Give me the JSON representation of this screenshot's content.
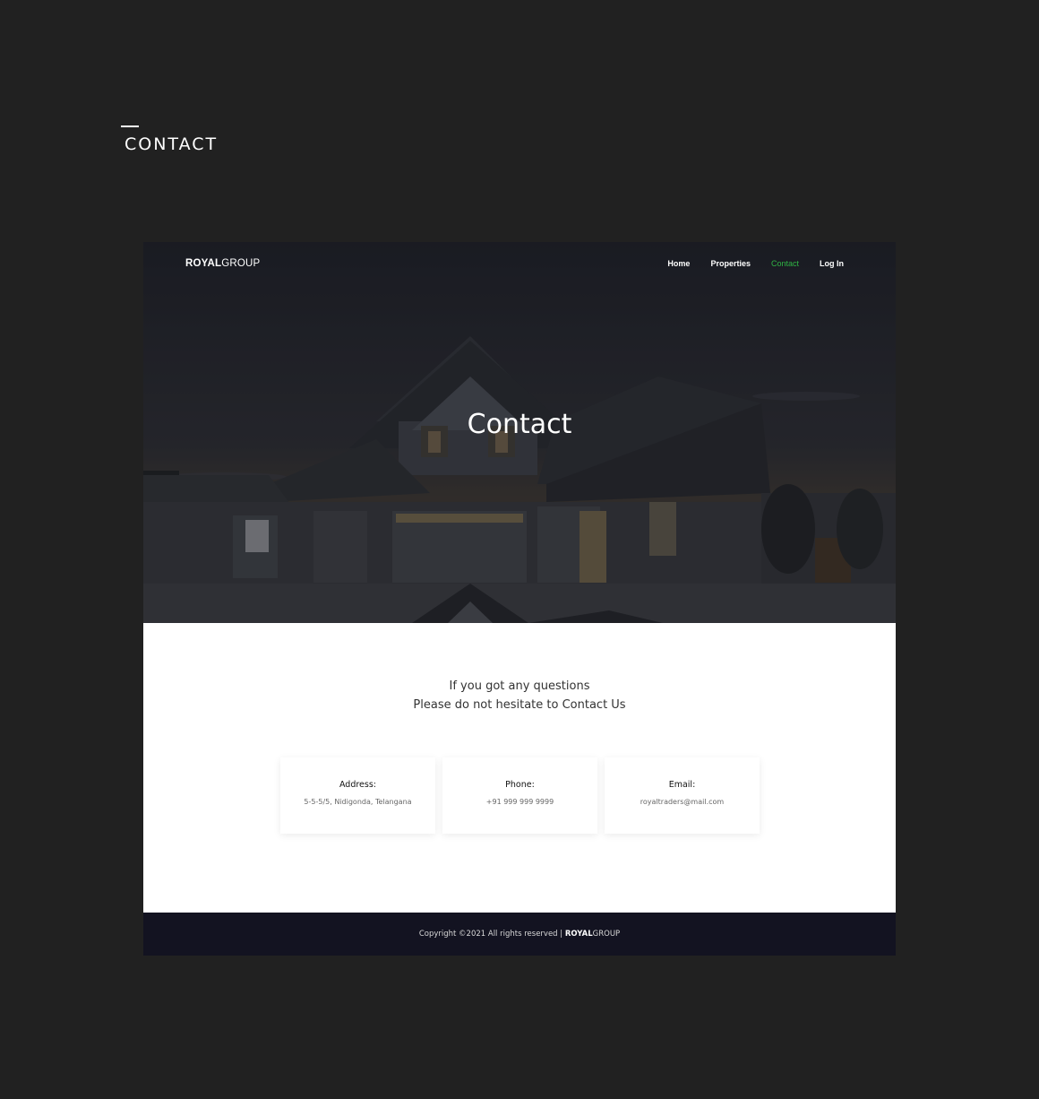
{
  "section": {
    "title": "CONTACT"
  },
  "brand": {
    "bold": "ROYAL",
    "light": "GROUP"
  },
  "nav": {
    "home": "Home",
    "properties": "Properties",
    "contact": "Contact",
    "login": "Log In"
  },
  "hero": {
    "title": "Contact"
  },
  "tagline": {
    "line1": "If you got any questions",
    "line2": "Please do not hesitate to Contact Us"
  },
  "cards": [
    {
      "label": "Address:",
      "value": "5-5-5/5, Nidigonda, Telangana"
    },
    {
      "label": "Phone:",
      "value": "+91 999 999 9999"
    },
    {
      "label": "Email:",
      "value": "royaltraders@mail.com"
    }
  ],
  "footer": {
    "text": "Copyright ©2021 All rights reserved | ",
    "brand_bold": "ROYAL",
    "brand_light": "GROUP"
  },
  "colors": {
    "page_bg": "#212121",
    "accent": "#2fb344",
    "footer_bg": "#131321"
  }
}
